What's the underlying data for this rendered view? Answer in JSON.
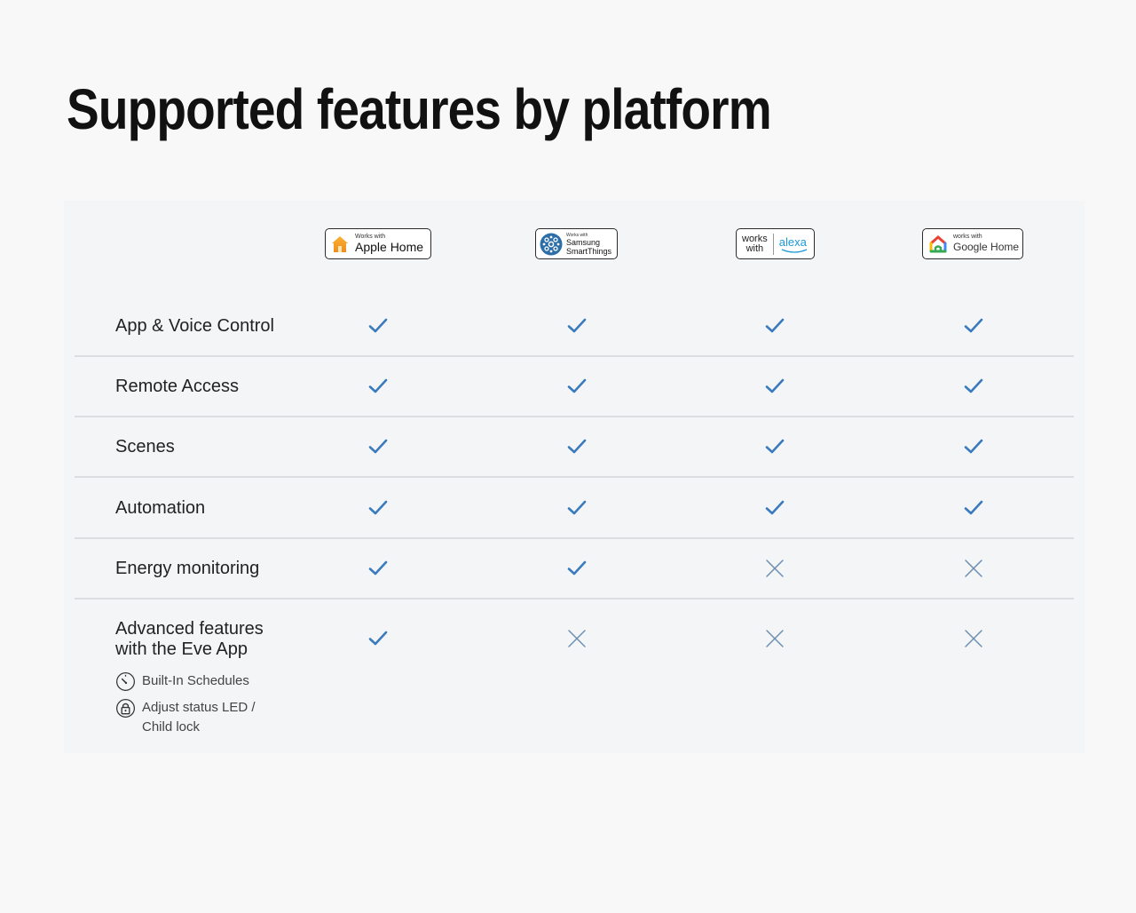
{
  "title": "Supported features by platform",
  "platforms": [
    {
      "name": "Apple Home",
      "badge_small": "Works with",
      "badge_big": "Apple Home",
      "icon": "apple-home-icon"
    },
    {
      "name": "Samsung SmartThings",
      "badge_small": "Works with",
      "badge_big_line1": "Samsung",
      "badge_big_line2": "SmartThings",
      "icon": "smartthings-icon"
    },
    {
      "name": "Alexa",
      "badge_small_line1": "works",
      "badge_small_line2": "with",
      "badge_big": "alexa",
      "icon": "alexa-smile-icon"
    },
    {
      "name": "Google Home",
      "badge_small": "works with",
      "badge_big": "Google Home",
      "icon": "google-home-icon"
    }
  ],
  "features": [
    {
      "label": "App & Voice Control",
      "support": [
        true,
        true,
        true,
        true
      ]
    },
    {
      "label": "Remote Access",
      "support": [
        true,
        true,
        true,
        true
      ]
    },
    {
      "label": "Scenes",
      "support": [
        true,
        true,
        true,
        true
      ]
    },
    {
      "label": "Automation",
      "support": [
        true,
        true,
        true,
        true
      ]
    },
    {
      "label": "Energy monitoring",
      "support": [
        true,
        true,
        false,
        false
      ]
    },
    {
      "label_line1": "Advanced features",
      "label_line2": "with the Eve App",
      "support": [
        true,
        false,
        false,
        false
      ]
    }
  ],
  "advanced_sub_features": [
    {
      "label": "Built-In Schedules",
      "icon": "timer-icon"
    },
    {
      "label": "Adjust status LED / Child lock",
      "icon": "lock-icon"
    }
  ],
  "colors": {
    "check": "#3a7bbd",
    "cross": "#6d8fb2",
    "divider": "#dcdde0",
    "alexa": "#1a98d5"
  }
}
